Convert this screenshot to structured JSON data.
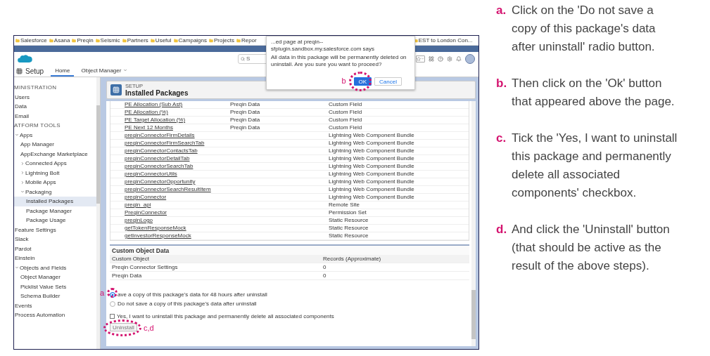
{
  "bookmarks": [
    {
      "label": "Salesforce"
    },
    {
      "label": "Asana"
    },
    {
      "label": "Preqin"
    },
    {
      "label": "Seismic"
    },
    {
      "label": "Partners"
    },
    {
      "label": "Useful"
    },
    {
      "label": "Campaigns"
    },
    {
      "label": "Projects"
    },
    {
      "label": "Repor"
    },
    {
      "label": "EST to London Con..."
    }
  ],
  "search": {
    "placeholder": "S"
  },
  "nav": {
    "app_title": "Setup",
    "tabs": [
      {
        "label": "Home",
        "selected": true
      },
      {
        "label": "Object Manager",
        "selected": false
      }
    ]
  },
  "sidebar": {
    "items": [
      {
        "label": "MINISTRATION",
        "kind": "heading"
      },
      {
        "label": "Users",
        "kind": "link"
      },
      {
        "label": "Data",
        "kind": "link"
      },
      {
        "label": "Email",
        "kind": "link"
      },
      {
        "label": "ATFORM TOOLS",
        "kind": "heading"
      },
      {
        "label": "Apps",
        "kind": "group",
        "expanded": true,
        "selected": false,
        "children": [
          {
            "label": "App Manager",
            "kind": "link",
            "selected": false
          },
          {
            "label": "AppExchange Marketplace",
            "kind": "link",
            "selected": false
          },
          {
            "label": "Connected Apps",
            "kind": "group",
            "expanded": false,
            "selected": false
          },
          {
            "label": "Lightning Bolt",
            "kind": "group",
            "expanded": false,
            "selected": false
          },
          {
            "label": "Mobile Apps",
            "kind": "group",
            "expanded": false,
            "selected": false
          },
          {
            "label": "Packaging",
            "kind": "group",
            "expanded": true,
            "selected": false,
            "children": [
              {
                "label": "Installed Packages",
                "kind": "link",
                "selected": true
              },
              {
                "label": "Package Manager",
                "kind": "link",
                "selected": false
              },
              {
                "label": "Package Usage",
                "kind": "link",
                "selected": false
              }
            ]
          }
        ]
      },
      {
        "label": "Feature Settings",
        "kind": "link"
      },
      {
        "label": "Slack",
        "kind": "link"
      },
      {
        "label": "Pardot",
        "kind": "link"
      },
      {
        "label": "Einstein",
        "kind": "link"
      },
      {
        "label": "Objects and Fields",
        "kind": "group",
        "expanded": true,
        "selected": false,
        "children": [
          {
            "label": "Object Manager",
            "kind": "link",
            "selected": false
          },
          {
            "label": "Picklist Value Sets",
            "kind": "link",
            "selected": false
          },
          {
            "label": "Schema Builder",
            "kind": "link",
            "selected": false
          }
        ]
      },
      {
        "label": "Events",
        "kind": "link"
      },
      {
        "label": "Process Automation",
        "kind": "link"
      }
    ]
  },
  "page_header": {
    "overline": "SETUP",
    "title": "Installed Packages"
  },
  "components": {
    "rows": [
      {
        "name": "PE Allocation (Sub Ast)",
        "parent": "Preqin Data",
        "type": "Custom Field"
      },
      {
        "name": "PE Allocation (%)",
        "parent": "Preqin Data",
        "type": "Custom Field"
      },
      {
        "name": "PE Target Allocation (%)",
        "parent": "Preqin Data",
        "type": "Custom Field"
      },
      {
        "name": "PE Next 12 Months",
        "parent": "Preqin Data",
        "type": "Custom Field"
      },
      {
        "name": "preqinConnectorFirmDetails",
        "type": "Lightning Web Component Bundle"
      },
      {
        "name": "preqinConnectorFirmSearchTab",
        "type": "Lightning Web Component Bundle"
      },
      {
        "name": "preqinConnectorContactsTab",
        "type": "Lightning Web Component Bundle"
      },
      {
        "name": "preqinConnectorDetailTab",
        "type": "Lightning Web Component Bundle"
      },
      {
        "name": "preqinConnectorSearchTab",
        "type": "Lightning Web Component Bundle"
      },
      {
        "name": "preqinConnectorUtils",
        "type": "Lightning Web Component Bundle"
      },
      {
        "name": "preqinConnectorOpportunity",
        "type": "Lightning Web Component Bundle"
      },
      {
        "name": "preqinConnectorSearchResultItem",
        "type": "Lightning Web Component Bundle"
      },
      {
        "name": "preqinConnector",
        "type": "Lightning Web Component Bundle"
      },
      {
        "name": "preqin_api",
        "type": "Remote Site"
      },
      {
        "name": "PreqinConnector",
        "type": "Permission Set"
      },
      {
        "name": "preqinLogo",
        "type": "Static Resource"
      },
      {
        "name": "getTokenResponseMock",
        "type": "Static Resource"
      },
      {
        "name": "getInvestorResponseMock",
        "type": "Static Resource"
      }
    ]
  },
  "custom_object_data": {
    "title": "Custom Object Data",
    "columns": [
      "Custom Object",
      "Records (Approximate)"
    ],
    "rows": [
      [
        "Preqin Connector Settings",
        "0"
      ],
      [
        "Preqin Data",
        "0"
      ]
    ]
  },
  "uninstall_options": [
    {
      "label": "ave a copy of this package's data for 48 hours after uninstall",
      "selected": true
    },
    {
      "label": "Do not save a copy of this package's data after uninstall",
      "selected": false
    }
  ],
  "confirm_checkbox": {
    "label": "Yes, I want to uninstall this package and permanently delete all associated components",
    "checked": false
  },
  "uninstall_button": {
    "label": "Uninstall",
    "disabled": true
  },
  "dialog": {
    "title": "...ed page at preqin--sfplugin.sandbox.my.salesforce.com says",
    "message": "All data in this package will be permanently deleted on uninstall. Are you sure you want to proceed?",
    "buttons": [
      {
        "label": "OK",
        "kind": "primary"
      },
      {
        "label": "Cancel",
        "kind": "secondary"
      }
    ]
  },
  "annotations": [
    {
      "label": "a"
    },
    {
      "label": "b"
    },
    {
      "label": "c,d"
    }
  ],
  "steps": [
    {
      "letter": "a.",
      "text": "Click on the 'Do not save a copy of this package's data after uninstall' radio button."
    },
    {
      "letter": "b.",
      "text": "Then click on the 'Ok' button that appeared above the page."
    },
    {
      "letter": "c.",
      "text": "Tick the 'Yes, I want to uninstall this package and permanently delete all associated components' checkbox."
    },
    {
      "letter": "d.",
      "text": "And click the 'Uninstall' button (that should be active as the result of the above steps)."
    }
  ]
}
